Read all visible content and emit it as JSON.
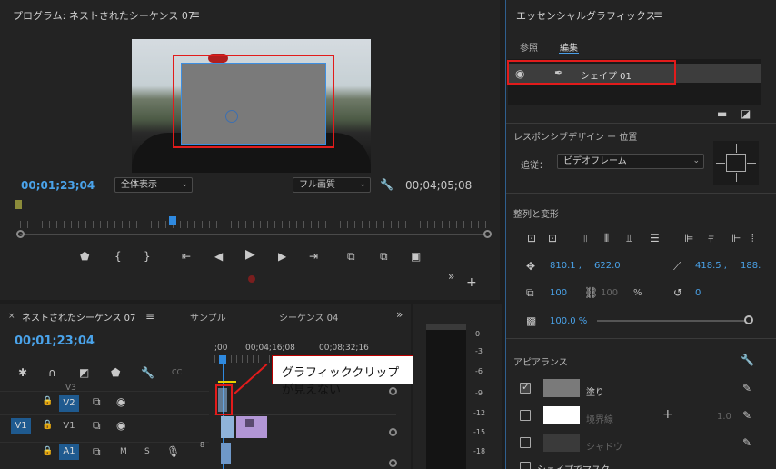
{
  "program": {
    "title": "プログラム: ネストされたシーケンス 07",
    "menu_icon": "≡",
    "timecode_left": "00;01;23;04",
    "zoom_select": "全体表示",
    "quality_select": "フル画質",
    "timecode_right": "00;04;05;08"
  },
  "timeline": {
    "tabs": [
      "ネストされたシーケンス 07",
      "サンプル",
      "シーケンス 04"
    ],
    "menu_icon": "≡",
    "timecode": "00;01;23;04",
    "ruler_labels": [
      ";00",
      "00;04;16;08",
      "00;08;32;16"
    ],
    "tracks": {
      "v3_label": "V3",
      "v2_label": "V2",
      "v1_target": "V1",
      "v1_label": "V1",
      "a1_label": "A1",
      "m_label": "M",
      "s_label": "S"
    },
    "callout": "グラフィッククリップが見えない",
    "meter_labels": [
      "0",
      "-3",
      "-6",
      "-9",
      "-12",
      "-15",
      "-18"
    ],
    "meter_left_label": "8"
  },
  "essential_graphics": {
    "title": "エッセンシャルグラフィックス",
    "menu_icon": "≡",
    "tab_browse": "参照",
    "tab_edit": "編集",
    "layer_name": "シェイプ 01",
    "responsive_title": "レスポンシブデザイン ー 位置",
    "follow_label": "追従：",
    "follow_value": "ビデオフレーム",
    "align_title": "整列と変形",
    "pos_x": "810.1 ,",
    "pos_y": "622.0",
    "anchor_x": "418.5 ,",
    "anchor_y": "188.",
    "scale": "100",
    "scale_linked": "100",
    "scale_unit": "%",
    "rotation": "0",
    "opacity": "100.0 %",
    "appearance_title": "アピアランス",
    "fill_label": "塗り",
    "stroke_label": "境界線",
    "stroke_value": "1.0",
    "shadow_label": "シャドウ",
    "mask_label": "シェイプでマスク",
    "colors": {
      "fill": "#7a7a7a",
      "stroke": "#ffffff",
      "shadow": "#3a3a3a",
      "accent": "#4aa3ea",
      "highlight": "#e21b1b"
    }
  }
}
